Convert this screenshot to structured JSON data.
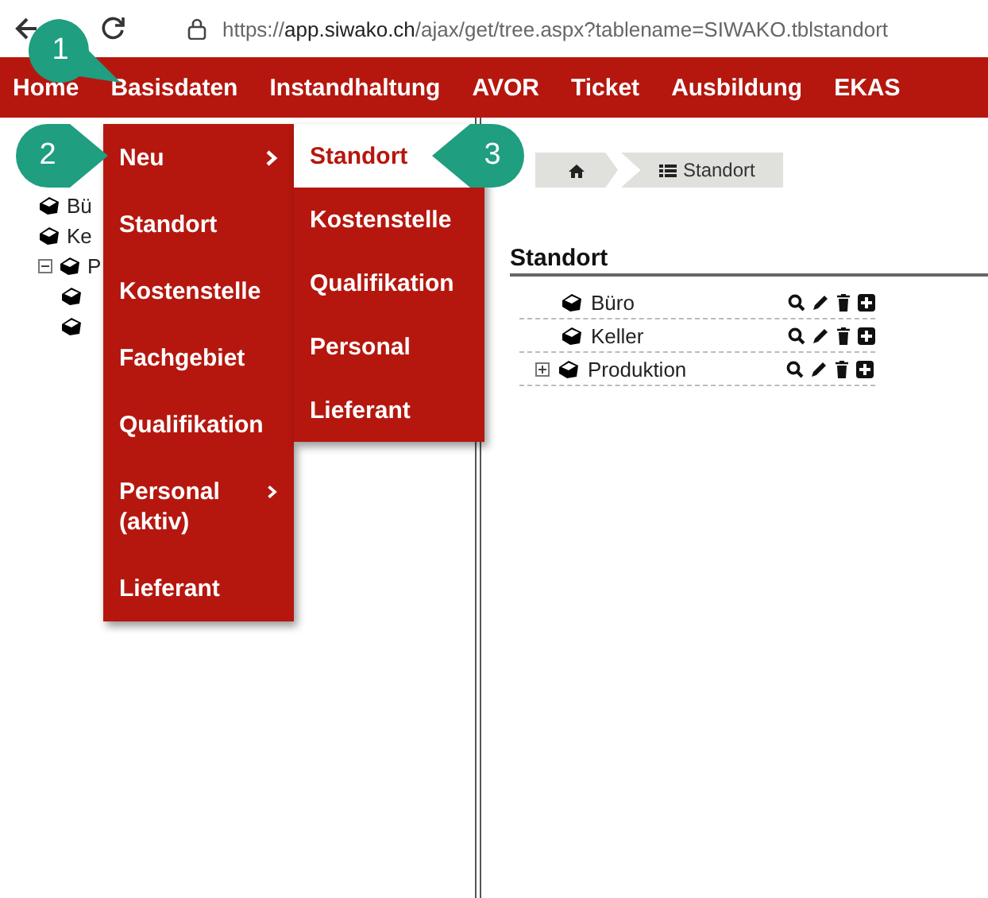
{
  "browser": {
    "url_scheme": "https://",
    "url_host": "app.siwako.ch",
    "url_path": "/ajax/get/tree.aspx?tablename=SIWAKO.tblstandort"
  },
  "nav": [
    "Home",
    "Basisdaten",
    "Instandhaltung",
    "AVOR",
    "Ticket",
    "Ausbildung",
    "EKAS"
  ],
  "menu": [
    {
      "label": "Neu",
      "submenu": true
    },
    {
      "label": "Standort",
      "submenu": false
    },
    {
      "label": "Kostenstelle",
      "submenu": false
    },
    {
      "label": "Fachgebiet",
      "submenu": false
    },
    {
      "label": "Qualifikation",
      "submenu": false
    },
    {
      "label": "Personal (aktiv)",
      "submenu": true
    },
    {
      "label": "Lieferant",
      "submenu": false
    }
  ],
  "submenu": [
    {
      "label": "Standort",
      "selected": true
    },
    {
      "label": "Kostenstelle",
      "selected": false
    },
    {
      "label": "Qualifikation",
      "selected": false
    },
    {
      "label": "Personal",
      "selected": false
    },
    {
      "label": "Lieferant",
      "selected": false
    }
  ],
  "callouts": [
    "1",
    "2",
    "3"
  ],
  "tree": [
    {
      "label": "Bü"
    },
    {
      "label": "Ke"
    },
    {
      "label": "P",
      "expanded": true,
      "children": [
        {
          "kind": "node"
        },
        {
          "kind": "node"
        }
      ]
    }
  ],
  "breadcrumb": {
    "label": "Standort"
  },
  "heading": "Standort",
  "rows": [
    {
      "label": "Büro",
      "kind": "leaf"
    },
    {
      "label": "Keller",
      "kind": "leaf"
    },
    {
      "label": "Produktion",
      "kind": "parent",
      "expanded": false
    }
  ]
}
